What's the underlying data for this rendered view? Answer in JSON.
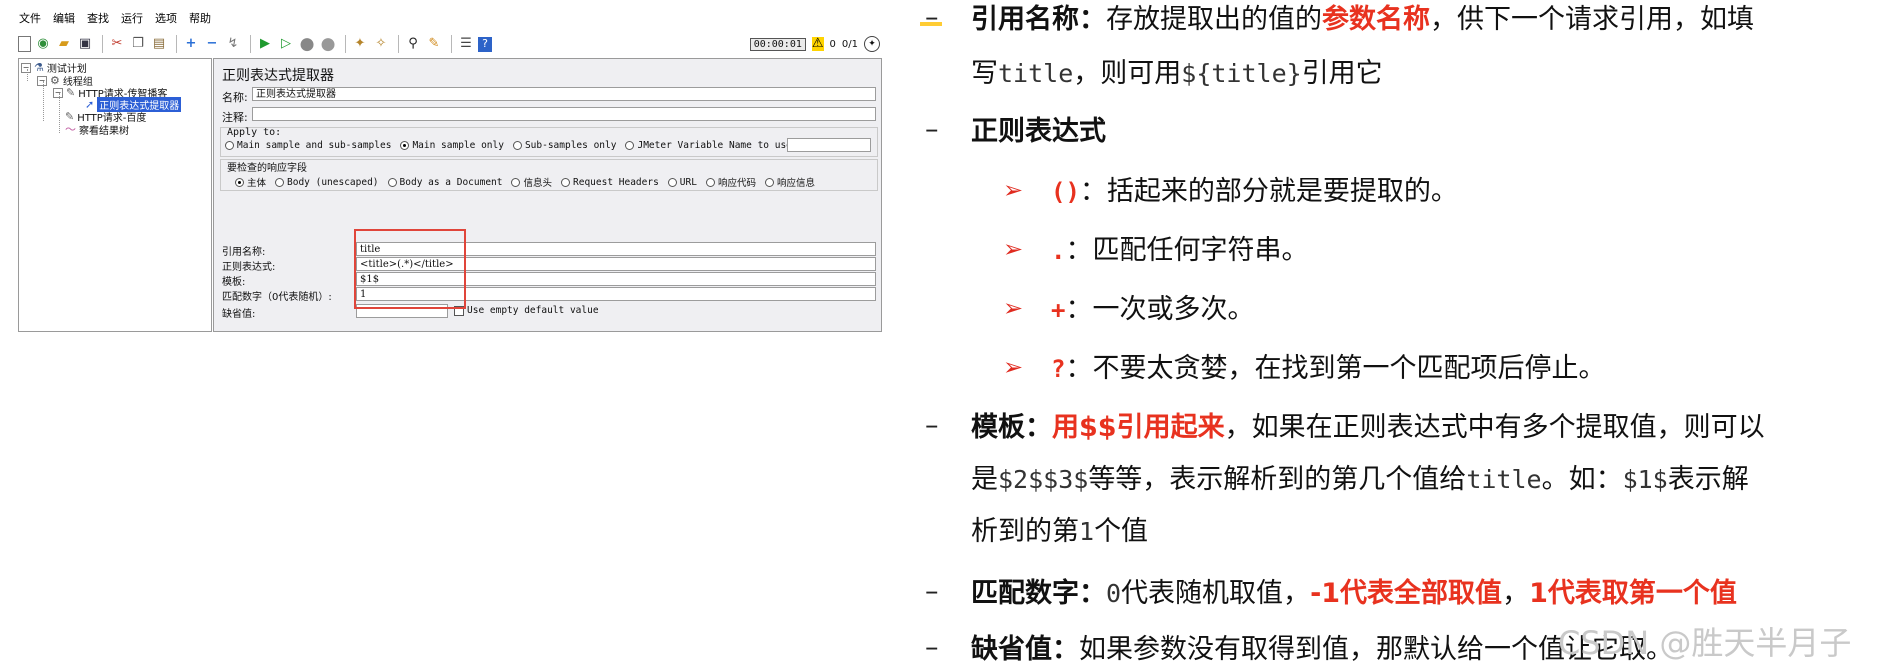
{
  "jmeter": {
    "menu": [
      "文件",
      "编辑",
      "查找",
      "运行",
      "选项",
      "帮助"
    ],
    "toolbar_icons": [
      "new-icon",
      "templates-icon",
      "open-icon",
      "save-icon",
      "cut-icon",
      "copy-icon",
      "paste-icon",
      "expand-icon",
      "collapse-icon",
      "toggle-icon",
      "start-icon",
      "start-no-pause-icon",
      "stop-icon",
      "shutdown-icon",
      "clear-icon",
      "clear-all-icon",
      "search-icon",
      "reset-search-icon",
      "function-helper-icon",
      "help-icon"
    ],
    "timer": "00:00:01",
    "warnings": "0",
    "threads": "0/1",
    "tree": {
      "test_plan": "测试计划",
      "thread_group": "线程组",
      "http_request_1": "HTTP请求-传智播客",
      "extractor": "正则表达式提取器",
      "http_request_2": "HTTP请求-百度",
      "listener": "察看结果树"
    },
    "panel": {
      "title": "正则表达式提取器",
      "name_label": "名称:",
      "name_value": "正则表达式提取器",
      "comment_label": "注释:",
      "apply_to_label": "Apply to:",
      "apply_options": [
        "Main sample and sub-samples",
        "Main sample only",
        "Sub-samples only",
        "JMeter Variable Name to use"
      ],
      "apply_selected": 1,
      "field_group_label": "要检查的响应字段",
      "field_options": [
        "主体",
        "Body (unescaped)",
        "Body as a Document",
        "信息头",
        "Request Headers",
        "URL",
        "响应代码",
        "响应信息"
      ],
      "field_selected": 0,
      "ref_name_label": "引用名称:",
      "ref_name_value": "title",
      "regex_label": "正则表达式:",
      "regex_value": "<title>(.*)</title>",
      "template_label": "模板:",
      "template_value": "$1$",
      "match_no_label": "匹配数字（0代表随机）:",
      "match_no_value": "1",
      "default_label": "缺省值:",
      "default_value": "",
      "empty_default_label": "Use empty default value"
    }
  },
  "notes": {
    "ref": {
      "term": "引用名称：",
      "t1": "存放提取出的值的",
      "t1_red": "参数名称",
      "t2": "，供下一个请求引用，如填",
      "line2_a": "写",
      "code1": "title",
      "line2_b": "，则可用",
      "code2": "${title}",
      "line2_c": "引用它"
    },
    "regex": {
      "term": "正则表达式",
      "items": [
        {
          "sym": "()",
          "desc": "：括起来的部分就是要提取的。"
        },
        {
          "sym": ".",
          "desc": "：匹配任何字符串。"
        },
        {
          "sym": "+",
          "desc": "：一次或多次。"
        },
        {
          "sym": "?",
          "desc": "：不要太贪婪，在找到第一个匹配项后停止。"
        }
      ],
      "bullet": "➢"
    },
    "template": {
      "term": "模板：",
      "red": "用$$引用起来",
      "t1": "，如果在正则表达式中有多个提取值，则可以",
      "l2_a": "是",
      "l2_code": "$2$$3$",
      "l2_b": "等等，表示解析到的第几个值给",
      "l2_code2": "title",
      "l2_c": "。如：",
      "l2_code3": "$1$",
      "l2_d": "表示解",
      "l3_a": "析到的第",
      "l3_code": "1",
      "l3_b": "个值"
    },
    "match": {
      "term": "匹配数字：",
      "code": "0",
      "t1": "代表随机取值，",
      "red1": "-1代表全部取值",
      "sep": "，",
      "red2": "1代表取第一个值"
    },
    "default": {
      "term": "缺省值：",
      "t1": "如果参数没有取得到值，那默认给一个值让它取。"
    },
    "dash": "–"
  },
  "watermark": "CSDN @胜天半月子"
}
